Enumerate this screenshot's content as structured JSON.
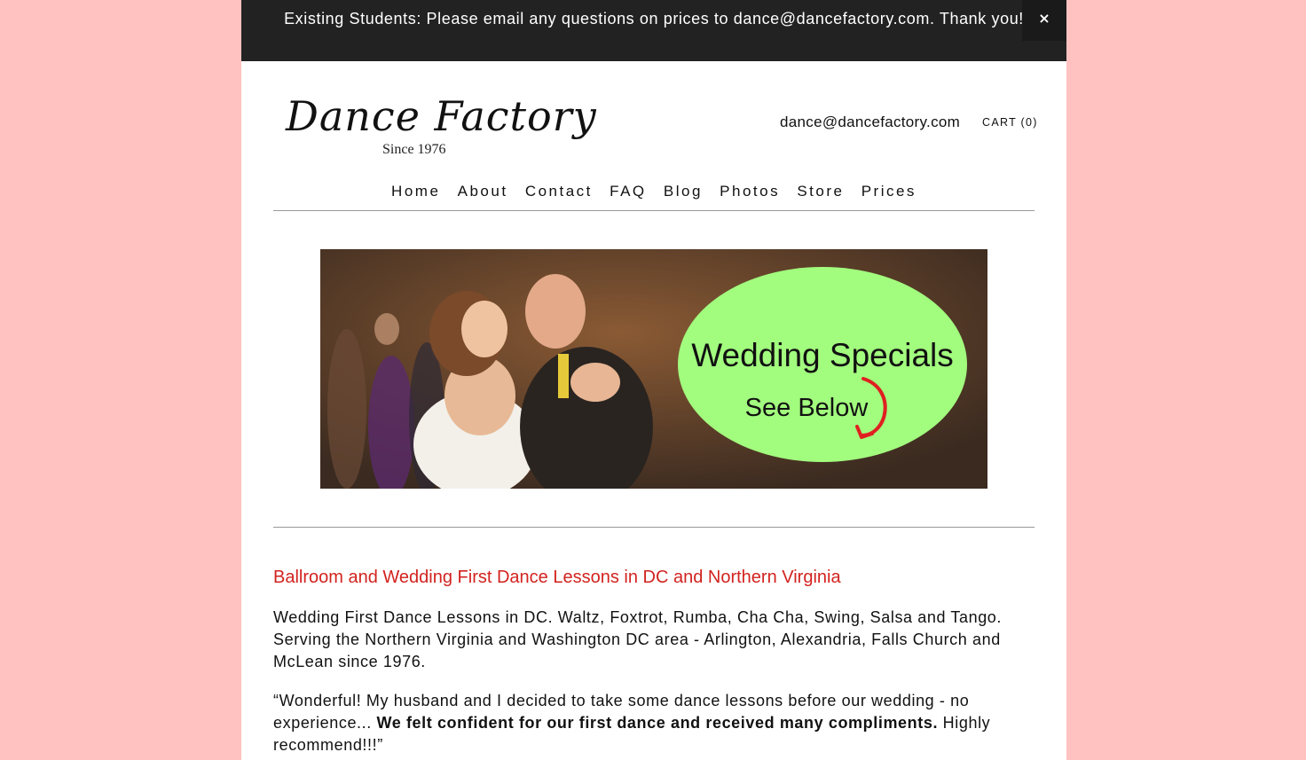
{
  "announcement": {
    "text": "Existing Students: Please email any questions on prices to dance@dancefactory.com. Thank you!",
    "close_label": "×"
  },
  "header": {
    "logo_title": "Dance Factory",
    "logo_subtitle": "Since 1976",
    "email": "dance@dancefactory.com",
    "cart_label": "CART (0)"
  },
  "nav": {
    "items": [
      "Home",
      "About",
      "Contact",
      "FAQ",
      "Blog",
      "Photos",
      "Store",
      "Prices"
    ]
  },
  "banner": {
    "title": "Wedding Specials",
    "subtitle": "See Below"
  },
  "content": {
    "heading": "Ballroom and Wedding First Dance Lessons in DC and Northern Virginia",
    "intro": "Wedding First Dance Lessons in DC. Waltz, Foxtrot, Rumba, Cha Cha, Swing, Salsa and Tango. Serving the Northern Virginia and Washington DC area - Arlington, Alexandria, Falls Church and McLean since 1976.",
    "testimonial_start": "“Wonderful! My husband and I decided to take some dance lessons before our wedding - no experience... ",
    "testimonial_bold": "We felt confident for our first dance and received many compliments.",
    "testimonial_end": " Highly recommend!!!”"
  },
  "colors": {
    "background": "#ffc2c0",
    "announcement_bar": "#222222",
    "heading": "#d2231f",
    "banner_oval": "#a2fc7e",
    "arrow": "#e02020"
  }
}
